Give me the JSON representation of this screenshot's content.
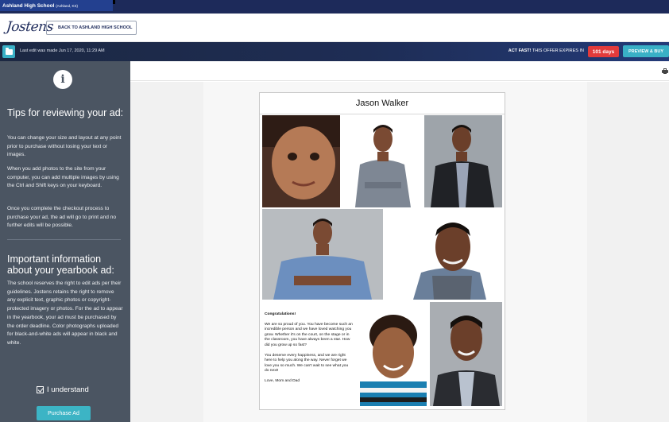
{
  "school": {
    "name": "Ashland High School",
    "location": "(Ashland, KS)"
  },
  "brand": {
    "logo_text": "Jostens",
    "back_button": "BACK TO ASHLAND HIGH SCHOOL"
  },
  "status": {
    "last_edit": "Last edit was made Jun 17, 2020, 11:29 AM",
    "offer_bold": "ACT FAST!",
    "offer_text": "THIS OFFER EXPIRES IN",
    "days": "101 days",
    "buy_button": "PREVIEW & BUY"
  },
  "sidebar": {
    "tips_title": "Tips for reviewing your ad:",
    "tips": [
      "You can change your size and layout at any point prior to purchase without losing your text or images.",
      "When you add photos to the site from your computer, you can add multiple images by using the Ctrl and Shift keys on your keyboard.",
      "Once you complete the checkout process to purchase your ad, the ad will go to print and no further edits will be possible."
    ],
    "info_title": "Important information about your yearbook ad:",
    "info_text": "The school reserves the right to edit ads per their guidelines. Jostens retains the right to remove any explicit text, graphic photos or copyright-protected imagery or photos. For the ad to appear in the yearbook, your ad must be purchased by the order deadline. Color photographs uploaded for black-and-white ads will appear in black and white.",
    "understand_label": "I understand",
    "purchase_button": "Purchase Ad"
  },
  "ad": {
    "title": "Jason Walker",
    "message": [
      "Congratulations!",
      "We are so proud of you. You have become such an incredible person and we have loved watching you grow. Whether it's on the court, on the stage or in the classroom, you have always been a star. How did you grow up so fast?",
      "You deserve every happiness, and we are right here to help you along the way. Never forget we love you so much. We can't wait to see what you do next!",
      "Love, Mom and Dad"
    ]
  },
  "colors": {
    "sidebar": "#4b5562",
    "accent": "#39b0c6",
    "badge": "#e23b3b",
    "navy": "#1d2a5a"
  }
}
